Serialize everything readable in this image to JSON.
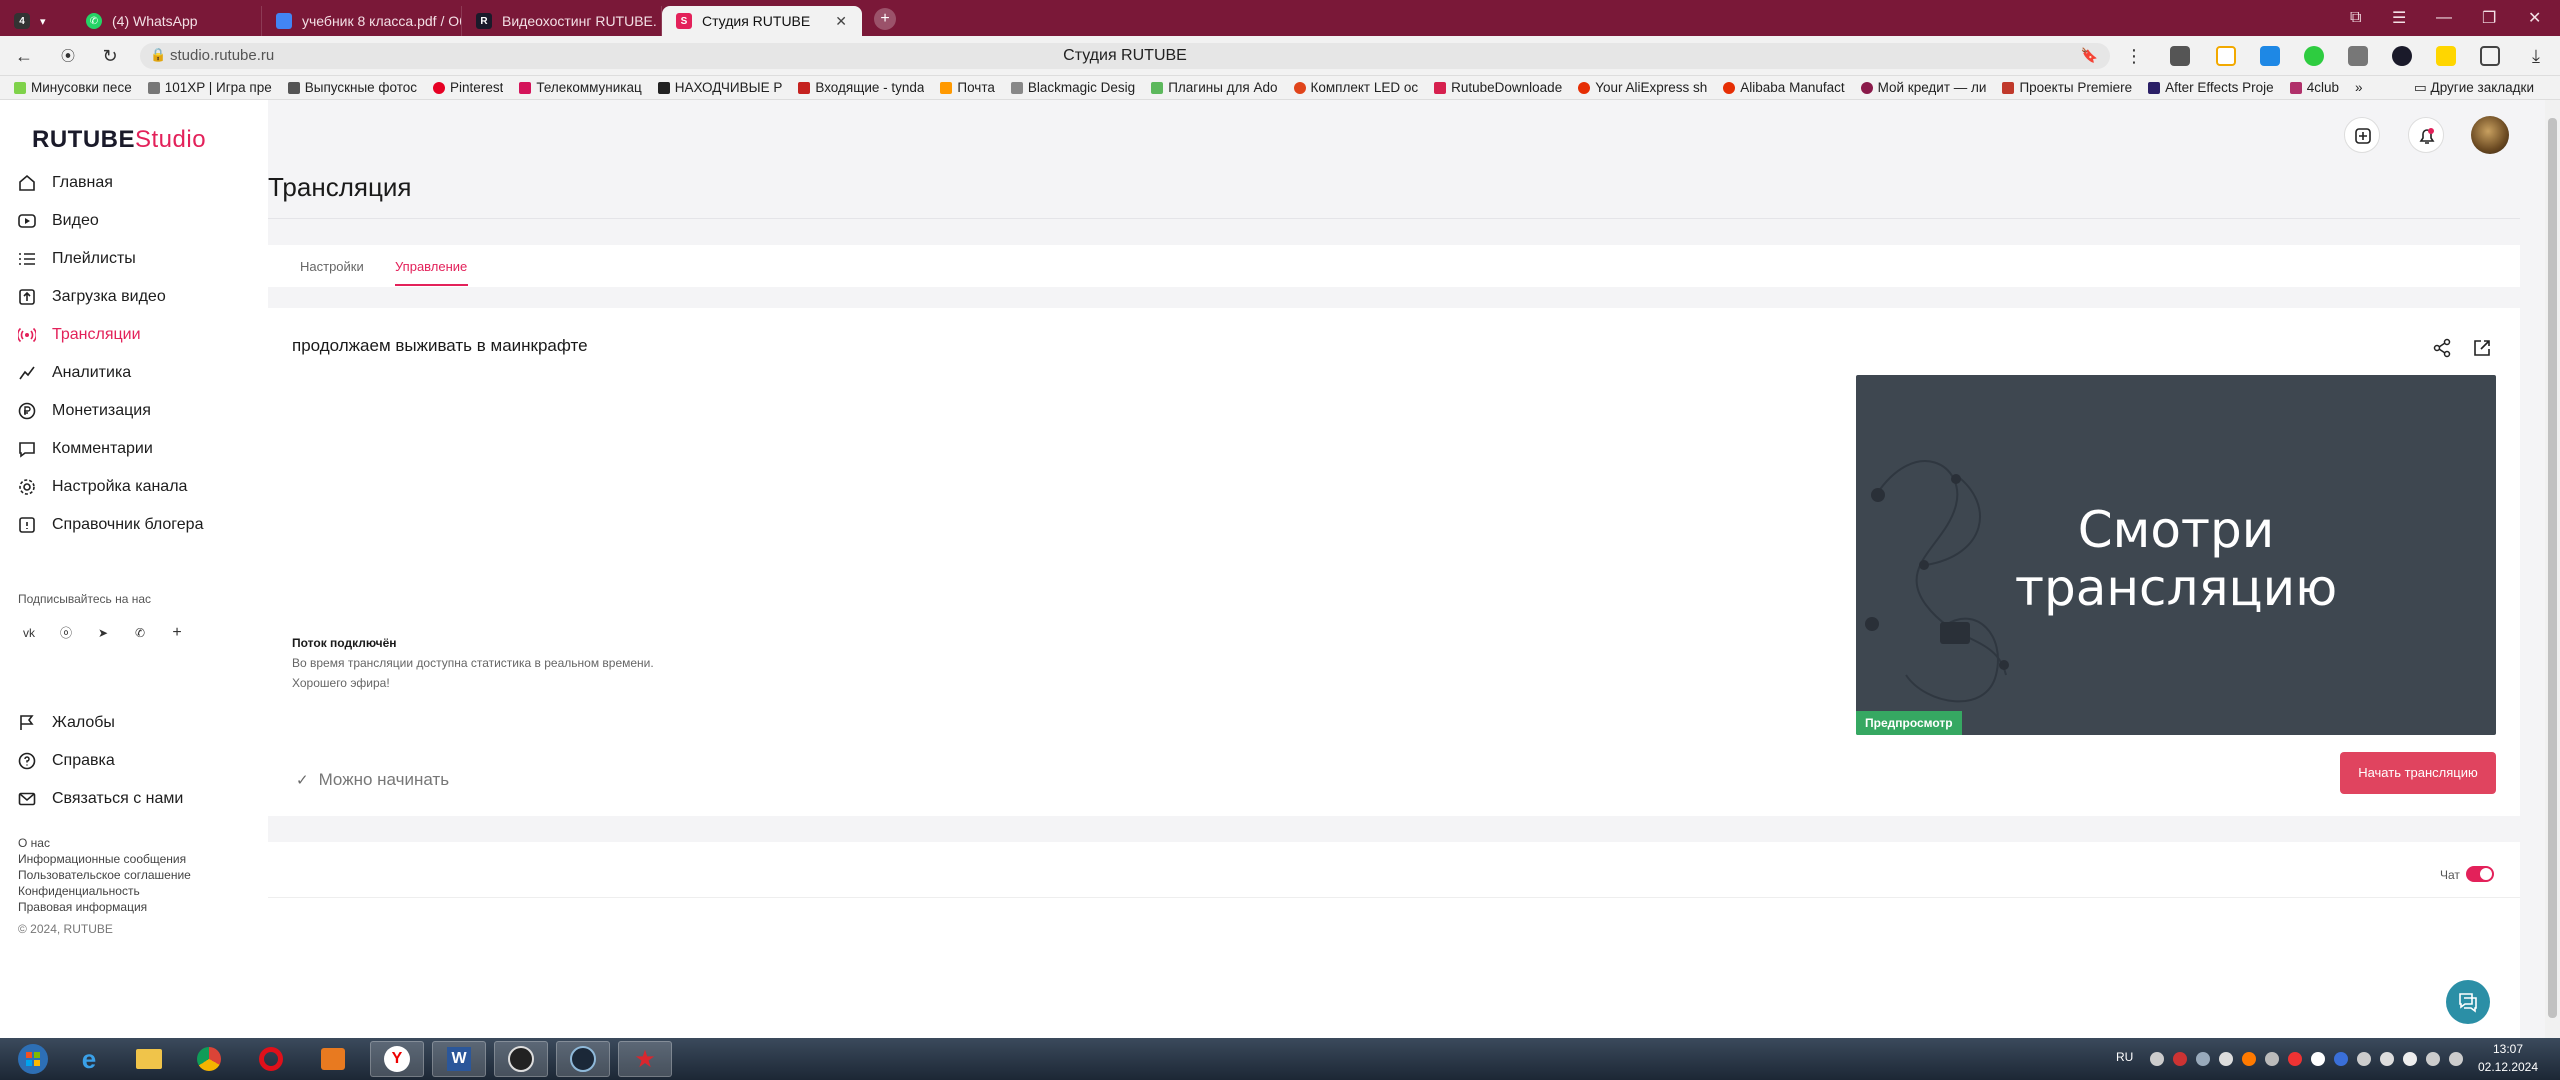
{
  "browser": {
    "tabs": [
      {
        "label": "",
        "type": "tab-actions"
      },
      {
        "label": "(4) WhatsApp",
        "favicon_color": "#25d366"
      },
      {
        "label": "учебник 8 класса.pdf / Об",
        "favicon_color": "#4285f4"
      },
      {
        "label": "Видеохостинг RUTUBE. С",
        "favicon_color": "#1a1a2a"
      },
      {
        "label": "Студия RUTUBE",
        "favicon_color": "#e3215a",
        "active": true
      }
    ],
    "new_tab": "+",
    "url": "studio.rutube.ru",
    "page_title": "Студия RUTUBE",
    "bookmarks": [
      {
        "label": "Минусовки песе",
        "color": "#7fd24a"
      },
      {
        "label": "101XP | Игра пре",
        "color": "#777"
      },
      {
        "label": "Выпускные фотос",
        "color": "#555"
      },
      {
        "label": "Pinterest",
        "color": "#e60023"
      },
      {
        "label": "Телекоммуникац",
        "color": "#d4145a"
      },
      {
        "label": "НАХОДЧИВЫЕ Р",
        "color": "#222"
      },
      {
        "label": "Входящие - tynda",
        "color": "#c5221f"
      },
      {
        "label": "Почта",
        "color": "#ff9900"
      },
      {
        "label": "Blackmagic Desig",
        "color": "#888"
      },
      {
        "label": "Плагины для Ado",
        "color": "#5cb85c"
      },
      {
        "label": "Комплект LED ос",
        "color": "#e0441a"
      },
      {
        "label": "RutubeDownloade",
        "color": "#d6204e"
      },
      {
        "label": "Your AliExpress sh",
        "color": "#e62e04"
      },
      {
        "label": "Alibaba Manufact",
        "color": "#e62e04"
      },
      {
        "label": "Мой кредит — ли",
        "color": "#8a1a4a"
      },
      {
        "label": "Проекты Premiere",
        "color": "#c0392b"
      },
      {
        "label": "After Effects Proje",
        "color": "#2a1f66"
      },
      {
        "label": "4club",
        "color": "#b0306a"
      }
    ],
    "bookmarks_more": "»",
    "other_bookmarks": "Другие закладки"
  },
  "sidebar": {
    "logo_main": "RUTUBE",
    "logo_sub": "Studio",
    "items": [
      {
        "label": "Главная",
        "icon": "home-icon"
      },
      {
        "label": "Видео",
        "icon": "video-icon"
      },
      {
        "label": "Плейлисты",
        "icon": "playlist-icon"
      },
      {
        "label": "Загрузка видео",
        "icon": "upload-icon"
      },
      {
        "label": "Трансляции",
        "icon": "broadcast-icon",
        "active": true
      },
      {
        "label": "Аналитика",
        "icon": "analytics-icon"
      },
      {
        "label": "Монетизация",
        "icon": "monetization-icon"
      },
      {
        "label": "Комментарии",
        "icon": "comments-icon"
      },
      {
        "label": "Настройка канала",
        "icon": "settings-icon"
      },
      {
        "label": "Справочник блогера",
        "icon": "guide-icon"
      }
    ],
    "follow_label": "Подписывайтесь на нас",
    "social": [
      {
        "label": "vk",
        "icon": "vk-icon"
      },
      {
        "label": "ok",
        "icon": "ok-icon"
      },
      {
        "label": "tg",
        "icon": "telegram-icon"
      },
      {
        "label": "vb",
        "icon": "viber-icon"
      },
      {
        "label": "+",
        "icon": "plus-icon"
      }
    ],
    "bottom_items": [
      {
        "label": "Жалобы",
        "icon": "flag-icon"
      },
      {
        "label": "Справка",
        "icon": "help-icon"
      },
      {
        "label": "Связаться с нами",
        "icon": "mail-icon"
      }
    ],
    "footer_links": [
      "О нас",
      "Информационные сообщения",
      "Пользовательское соглашение",
      "Конфиденциальность",
      "Правовая информация"
    ],
    "copyright": "© 2024, RUTUBE"
  },
  "main": {
    "title": "Трансляция",
    "tabs": [
      {
        "label": "Настройки"
      },
      {
        "label": "Управление",
        "active": true
      }
    ],
    "stream": {
      "title": "продолжаем выживать в маинкрафте",
      "status_title": "Поток подключён",
      "status_line1": "Во время трансляции доступна статистика в реальном времени.",
      "status_line2": "Хорошего эфира!",
      "preview_text": "Смотри трансляцию",
      "preview_badge": "Предпросмотр",
      "ready_text": "Можно начинать",
      "start_button": "Начать трансляцию"
    },
    "chat": {
      "label": "Чат",
      "enabled": true
    }
  },
  "taskbar": {
    "lang": "RU",
    "time": "13:07",
    "date": "02.12.2024"
  },
  "colors": {
    "accent": "#e3215a",
    "start_button": "#e0445f",
    "badge_green": "#36a862",
    "tab_strip": "#7a1838"
  }
}
